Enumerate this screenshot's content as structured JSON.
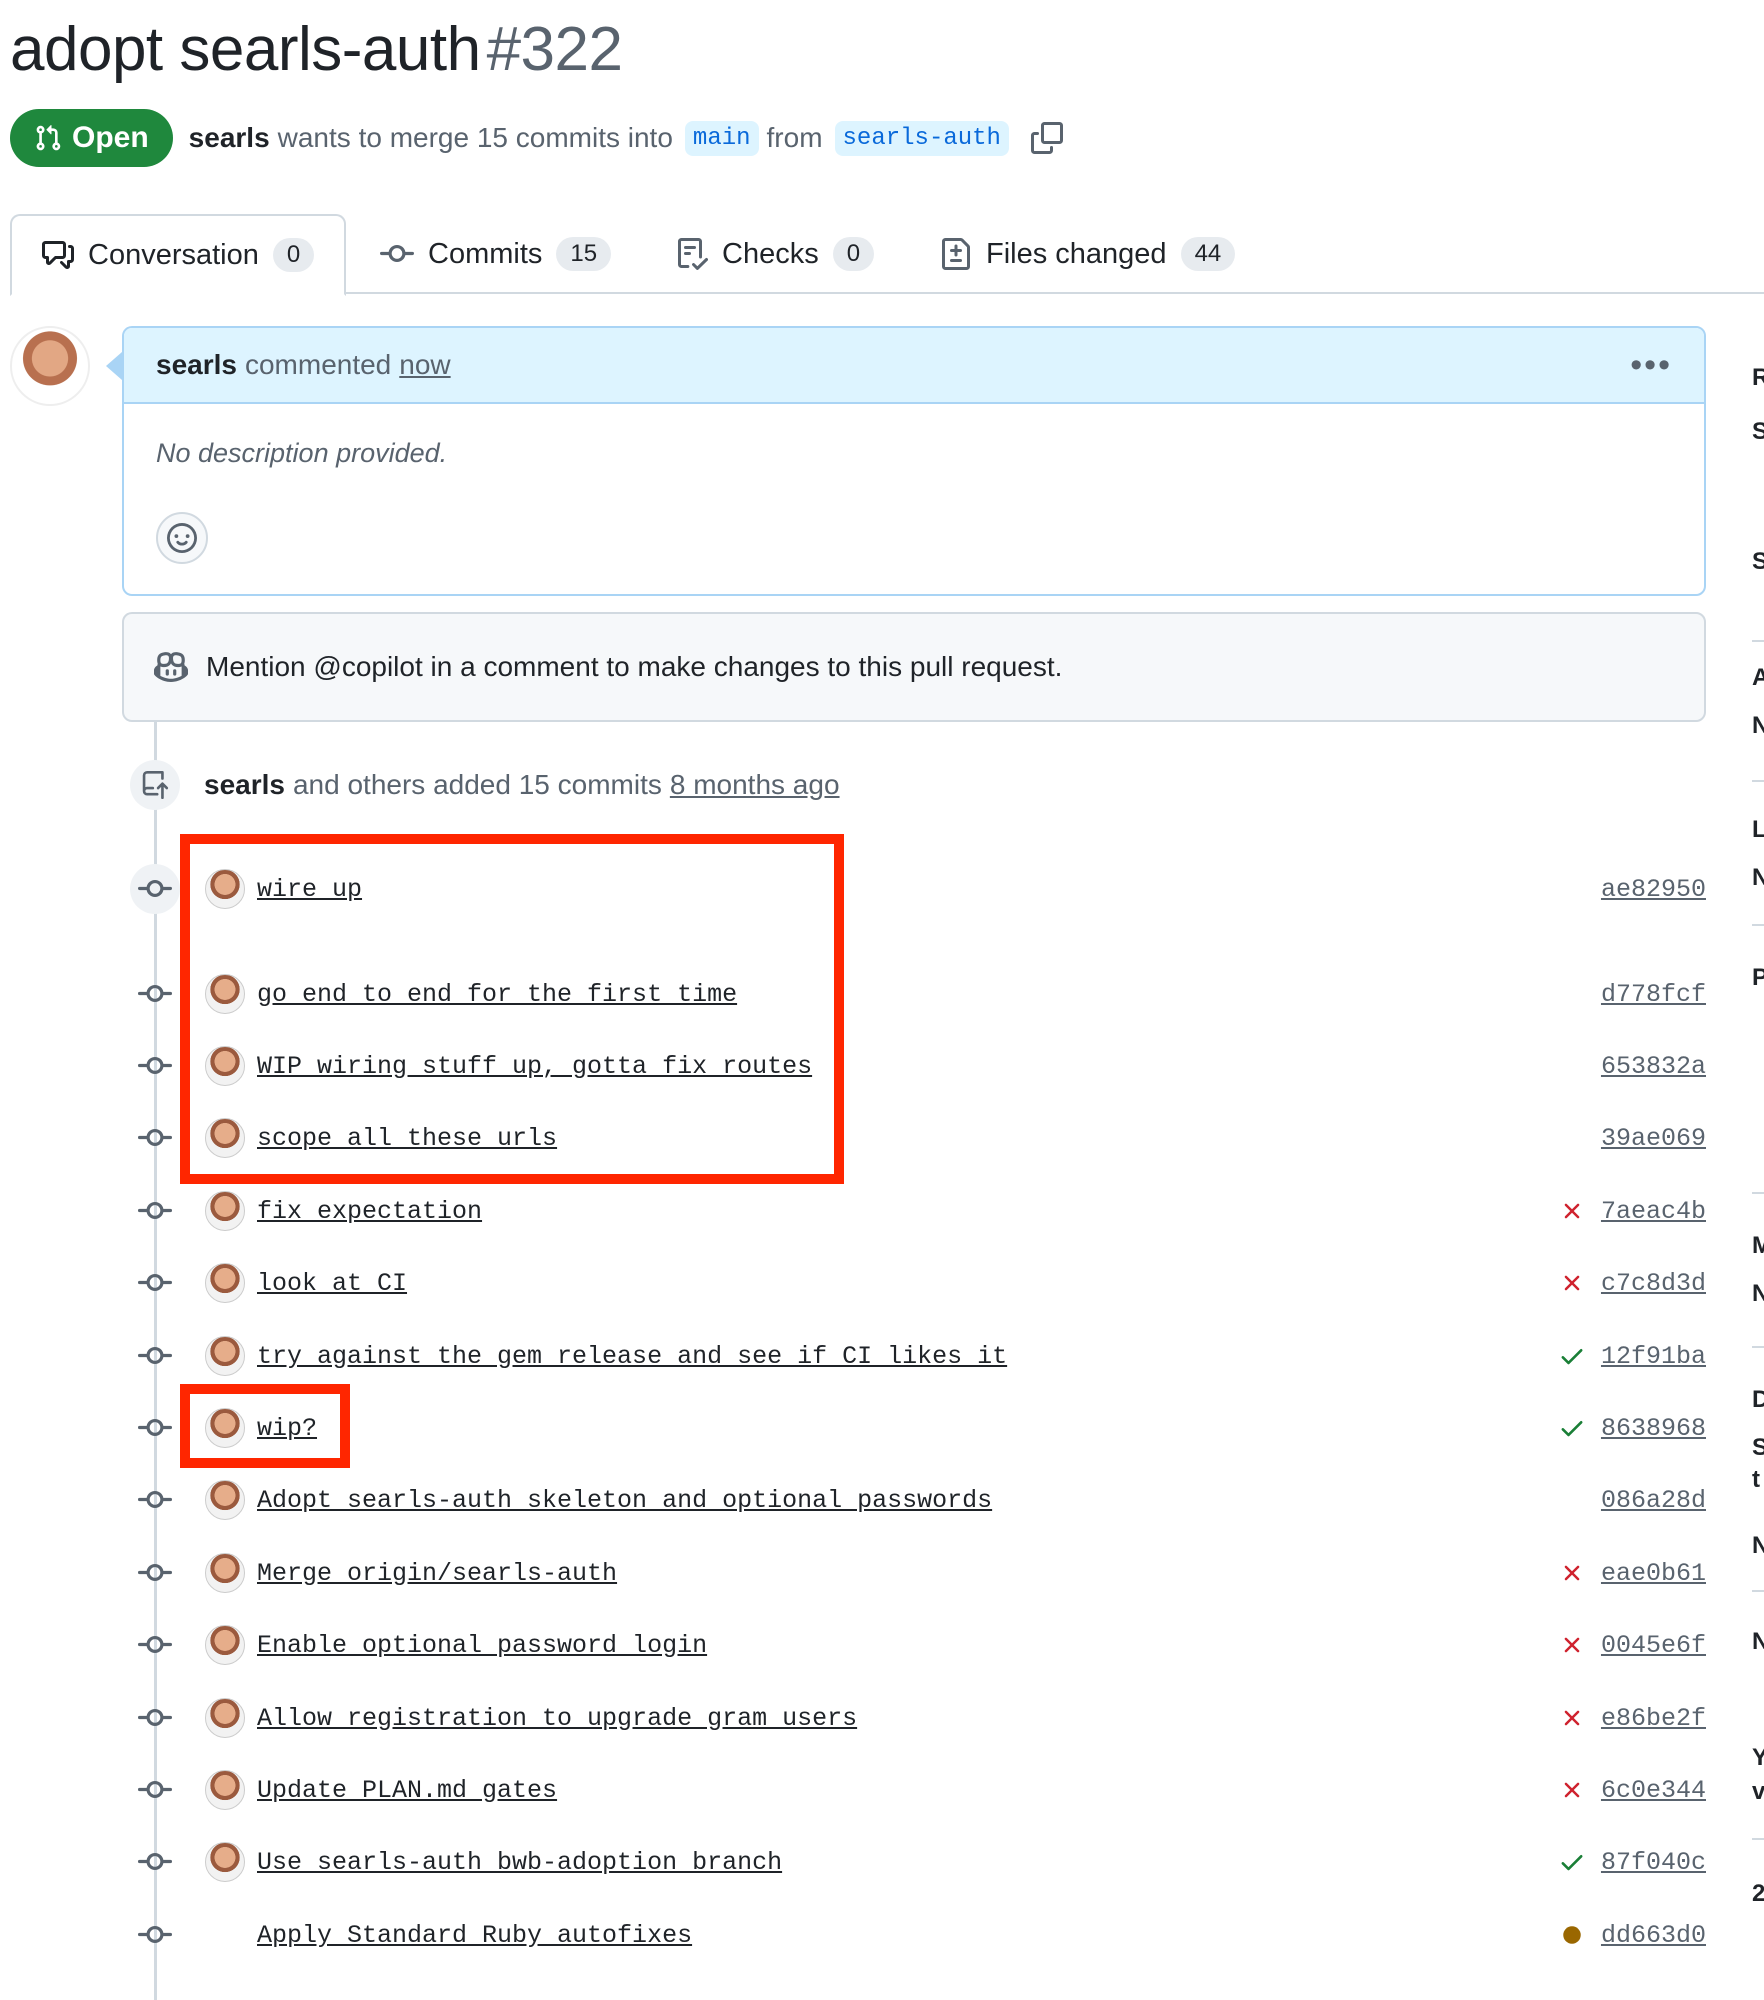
{
  "pr": {
    "title": "adopt searls-auth",
    "number": "#322",
    "state": "Open",
    "author": "searls",
    "merge_text": "wants to merge 15 commits into",
    "base_branch": "main",
    "from_text": "from",
    "head_branch": "searls-auth"
  },
  "tabs": [
    {
      "label": "Conversation",
      "count": "0"
    },
    {
      "label": "Commits",
      "count": "15"
    },
    {
      "label": "Checks",
      "count": "0"
    },
    {
      "label": "Files changed",
      "count": "44"
    }
  ],
  "comment": {
    "author": "searls",
    "action": "commented",
    "time": "now",
    "body": "No description provided."
  },
  "copilot_notice": "Mention @copilot in a comment to make changes to this pull request.",
  "push_event": {
    "author": "searls",
    "text": "and others added 15 commits",
    "time": "8 months ago"
  },
  "commits": [
    {
      "message": "wire up",
      "sha": "ae82950",
      "status": "none"
    },
    {
      "message": "go end to end for the first time",
      "sha": "d778fcf",
      "status": "none"
    },
    {
      "message": "WIP wiring stuff up, gotta fix routes",
      "sha": "653832a",
      "status": "none"
    },
    {
      "message": "scope all these urls",
      "sha": "39ae069",
      "status": "none"
    },
    {
      "message": "fix expectation",
      "sha": "7aeac4b",
      "status": "fail"
    },
    {
      "message": "look at CI",
      "sha": "c7c8d3d",
      "status": "fail"
    },
    {
      "message": "try against the gem release and see if CI likes it",
      "sha": "12f91ba",
      "status": "pass"
    },
    {
      "message": "wip?",
      "sha": "8638968",
      "status": "pass"
    },
    {
      "message": "Adopt searls-auth skeleton and optional passwords",
      "sha": "086a28d",
      "status": "none"
    },
    {
      "message": "Merge origin/searls-auth",
      "sha": "eae0b61",
      "status": "fail"
    },
    {
      "message": "Enable optional password login",
      "sha": "0045e6f",
      "status": "fail"
    },
    {
      "message": "Allow registration to upgrade gram users",
      "sha": "e86be2f",
      "status": "fail"
    },
    {
      "message": "Update PLAN.md gates",
      "sha": "6c0e344",
      "status": "fail"
    },
    {
      "message": "Use searls-auth bwb-adoption branch",
      "sha": "87f040c",
      "status": "pass"
    },
    {
      "message": "Apply Standard Ruby autofixes",
      "sha": "dd663d0",
      "status": "pending"
    }
  ],
  "sidebar_letters": [
    "R",
    "S",
    "S",
    "A",
    "N",
    "L",
    "N",
    "P",
    "M",
    "N",
    "D",
    "S",
    "t",
    "N",
    "N",
    "Y",
    "v",
    "2"
  ],
  "colors": {
    "open_green": "#1f883d",
    "fail_red": "#cf222e",
    "pass_green": "#1a7f37",
    "pending_amber": "#9a6700",
    "highlight_red": "#ff2600"
  }
}
